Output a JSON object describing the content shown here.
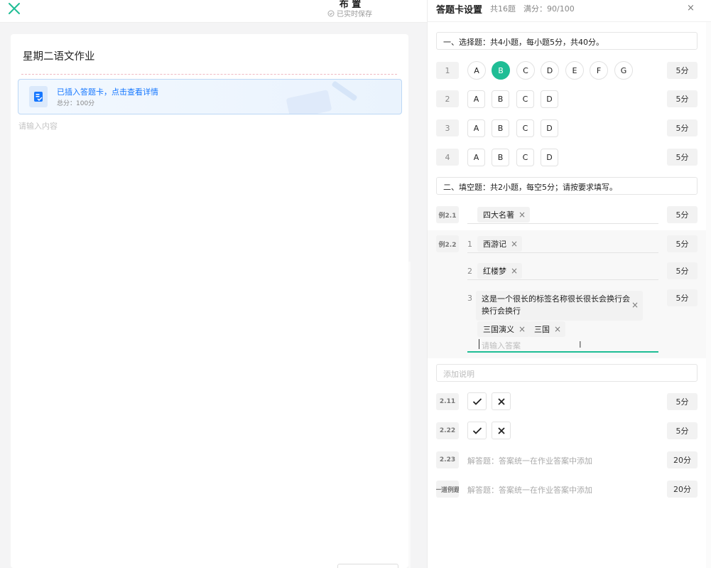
{
  "header": {
    "title": "布 置",
    "saved_status": "已实时保存"
  },
  "editor": {
    "doc_title": "星期二语文作业",
    "answer_card_link": "已插入答题卡，点击查看详情",
    "answer_card_score": "总分：100分",
    "content_placeholder": "请输入内容"
  },
  "panel": {
    "title": "答题卡设置",
    "meta": "共16题　满分：90/100",
    "close_glyph": "×",
    "sections": [
      "一、选择题：共4小题，每小题5分，共40分。",
      "二、填空题：共2小题，每空5分；请按要求填写。"
    ],
    "choice_questions": [
      {
        "num": "1",
        "options": [
          "A",
          "B",
          "C",
          "D",
          "E",
          "F",
          "G"
        ],
        "selected": "B",
        "score": "5分"
      },
      {
        "num": "2",
        "options": [
          "A",
          "B",
          "C",
          "D"
        ],
        "score": "5分"
      },
      {
        "num": "3",
        "options": [
          "A",
          "B",
          "C",
          "D"
        ],
        "score": "5分"
      },
      {
        "num": "4",
        "options": [
          "A",
          "B",
          "C",
          "D"
        ],
        "score": "5分"
      }
    ],
    "fill": {
      "q1": {
        "num": "例2.1",
        "tags": [
          "四大名著"
        ],
        "score": "5分"
      },
      "q2": {
        "num": "例2.2",
        "blanks": [
          {
            "num": "1",
            "tags": [
              "西游记"
            ],
            "score": "5分"
          },
          {
            "num": "2",
            "tags": [
              "红楼梦"
            ],
            "score": "5分"
          },
          {
            "num": "3",
            "long_tag": "这是一个很长的标签名称很长很长会换行会换行会换行",
            "tags": [
              "三国演义",
              "三国"
            ],
            "score": "5分",
            "placeholder": "请输入答案"
          }
        ]
      }
    },
    "add_description_placeholder": "添加说明",
    "judge_questions": [
      {
        "num": "2.11",
        "score": "5分"
      },
      {
        "num": "2.22",
        "score": "5分"
      }
    ],
    "essay_questions": [
      {
        "num": "2.23",
        "note": "解答题：答案统一在作业答案中添加",
        "score": "20分"
      },
      {
        "num": "一道例题",
        "note": "解答题：答案统一在作业答案中添加",
        "score": "20分"
      }
    ]
  },
  "colors": {
    "accent": "#1fbd95",
    "link": "#1677ff"
  }
}
